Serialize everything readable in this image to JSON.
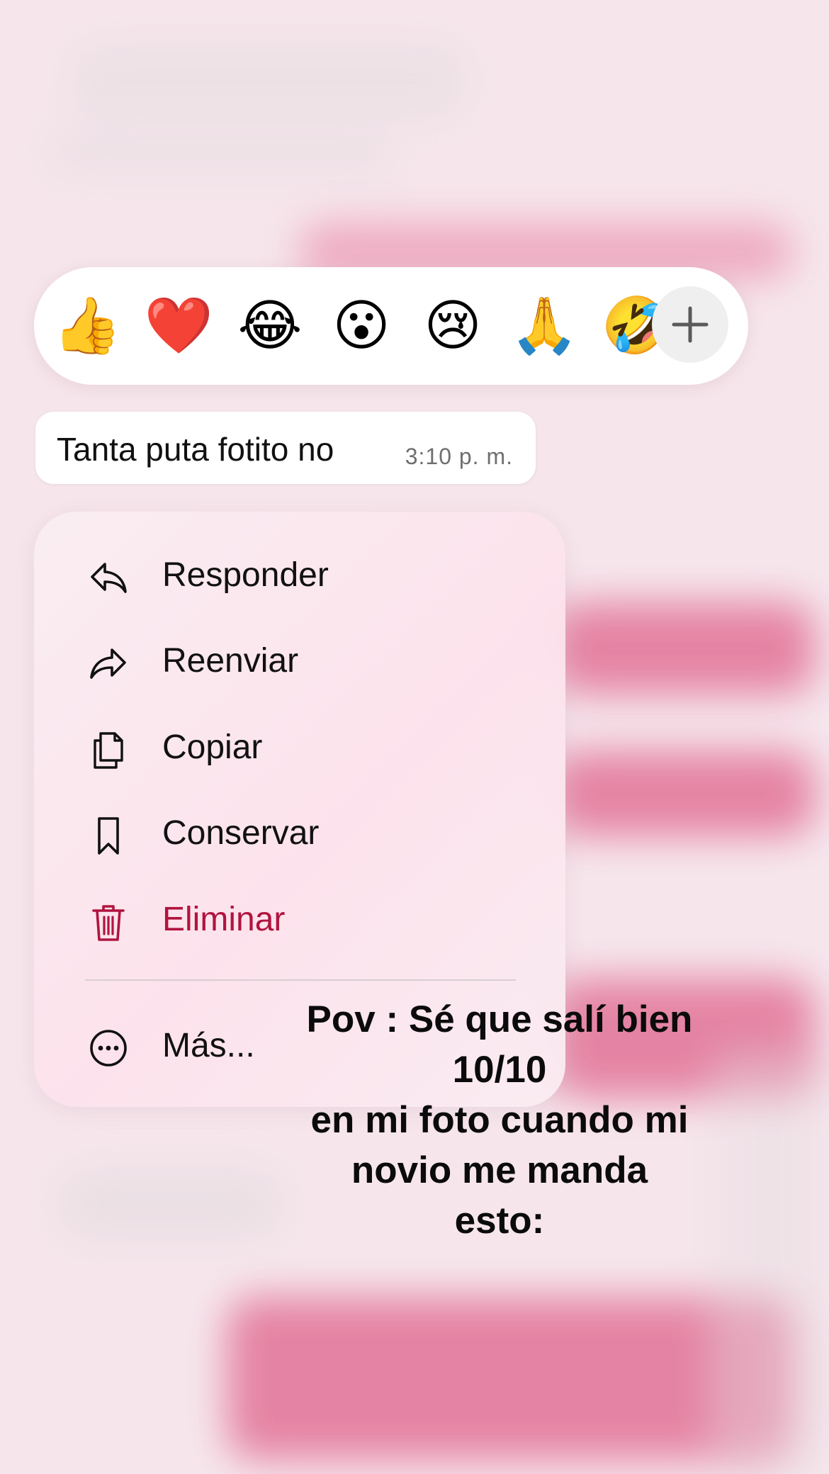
{
  "reactions": {
    "emojis": [
      {
        "name": "thumbs-up",
        "glyph": "👍"
      },
      {
        "name": "red-heart",
        "glyph": "❤️"
      },
      {
        "name": "tears-of-joy",
        "glyph": "😂"
      },
      {
        "name": "surprised",
        "glyph": "😮"
      },
      {
        "name": "crying",
        "glyph": "😢"
      },
      {
        "name": "folded-hands",
        "glyph": "🙏"
      },
      {
        "name": "rolling-on-floor-laughing",
        "glyph": "🤣"
      }
    ],
    "more_icon": "plus-icon"
  },
  "message": {
    "text": "Tanta puta fotito no",
    "time": "3:10 p. m."
  },
  "menu": {
    "items": [
      {
        "label": "Responder",
        "icon": "reply-icon"
      },
      {
        "label": "Reenviar",
        "icon": "forward-icon"
      },
      {
        "label": "Copiar",
        "icon": "copy-icon"
      },
      {
        "label": "Conservar",
        "icon": "bookmark-icon"
      },
      {
        "label": "Eliminar",
        "icon": "trash-icon"
      },
      {
        "label": "Más...",
        "icon": "more-icon"
      }
    ]
  },
  "caption": {
    "text": "Pov : Sé que salí bien\n10/10\nen mi foto cuando mi\nnovio me manda\nesto:"
  },
  "colors": {
    "background": "#f6e6ec",
    "danger": "#b0143f",
    "blurred_bubble": "#e3799c"
  }
}
